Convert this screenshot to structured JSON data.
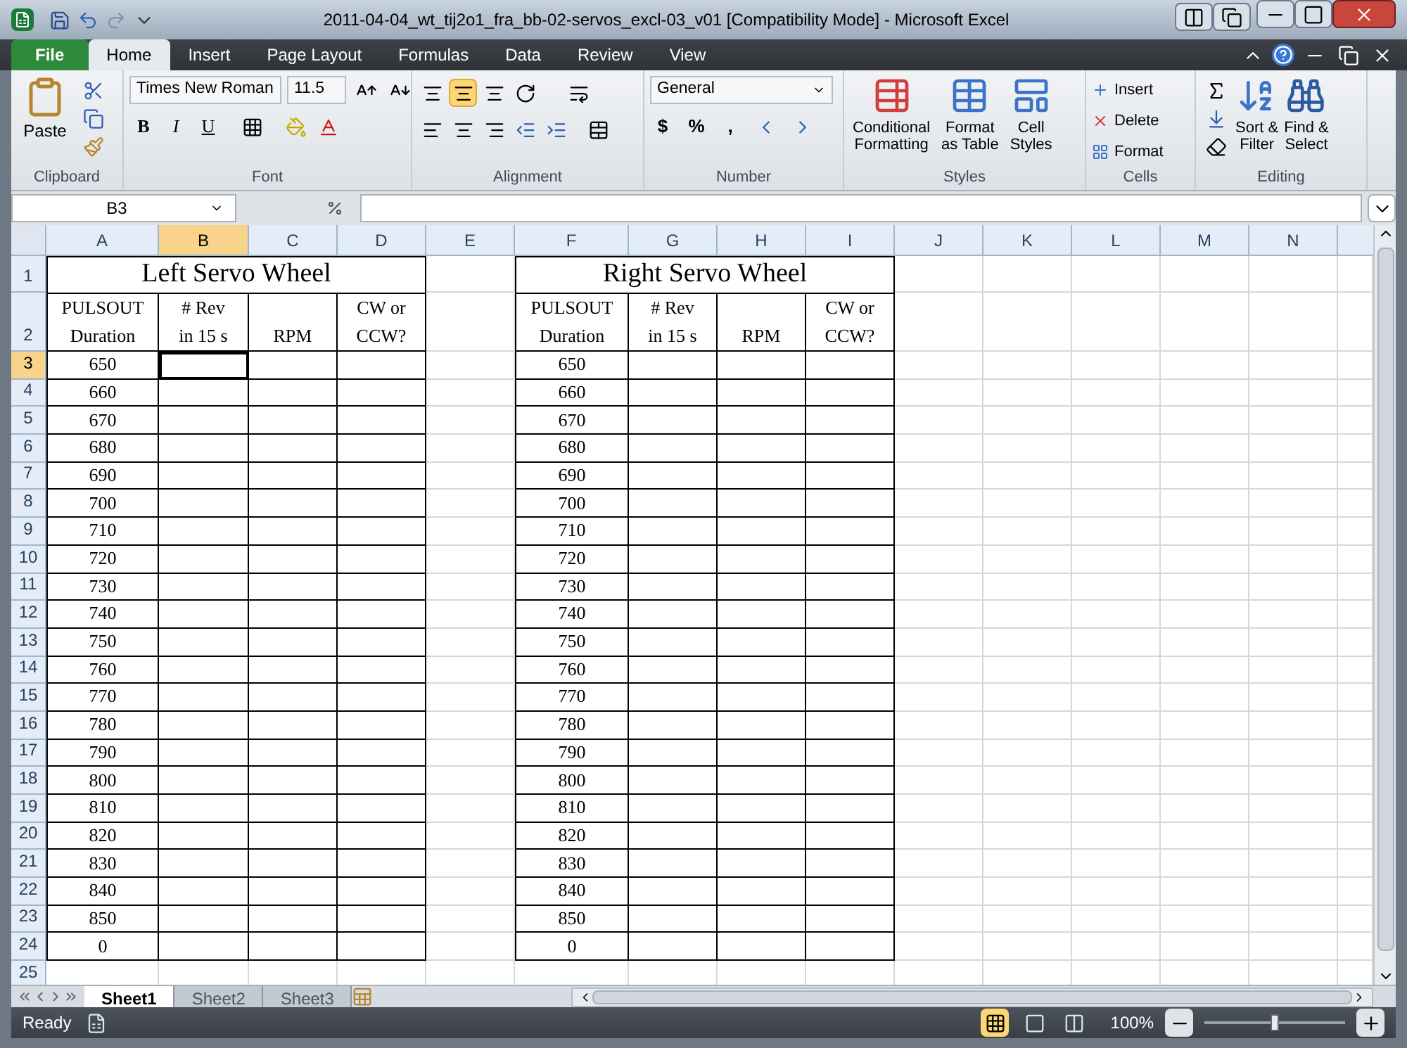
{
  "window": {
    "title": "2011-04-04_wt_tij2o1_fra_bb-02-servos_excl-03_v01  [Compatibility Mode]  -  Microsoft Excel"
  },
  "ribbon_tabs": [
    {
      "label": "File",
      "kind": "file",
      "selected": false
    },
    {
      "label": "Home",
      "kind": "tab",
      "selected": true
    },
    {
      "label": "Insert",
      "kind": "tab",
      "selected": false
    },
    {
      "label": "Page Layout",
      "kind": "tab",
      "selected": false
    },
    {
      "label": "Formulas",
      "kind": "tab",
      "selected": false
    },
    {
      "label": "Data",
      "kind": "tab",
      "selected": false
    },
    {
      "label": "Review",
      "kind": "tab",
      "selected": false
    },
    {
      "label": "View",
      "kind": "tab",
      "selected": false
    }
  ],
  "clipboard": {
    "label": "Clipboard",
    "paste": "Paste"
  },
  "font": {
    "label": "Font",
    "name": "Times New Roman",
    "size": "11.5",
    "styles": [
      "B",
      "I",
      "U"
    ]
  },
  "alignment": {
    "label": "Alignment",
    "middle_align_selected": true
  },
  "number": {
    "label": "Number",
    "format": "General",
    "symbols": [
      "$",
      "%",
      ","
    ]
  },
  "styles": {
    "label": "Styles",
    "buttons": [
      {
        "lines": [
          "Conditional",
          "Formatting"
        ]
      },
      {
        "lines": [
          "Format",
          "as Table"
        ]
      },
      {
        "lines": [
          "Cell",
          "Styles"
        ]
      }
    ]
  },
  "cells": {
    "label": "Cells",
    "buttons": [
      "Insert",
      "Delete",
      "Format"
    ]
  },
  "editing": {
    "label": "Editing",
    "buttons": [
      {
        "lines": [
          "Sort &",
          "Filter"
        ]
      },
      {
        "lines": [
          "Find &",
          "Select"
        ]
      }
    ]
  },
  "formula_bar": {
    "name_box": "B3"
  },
  "sheet": {
    "columns": [
      {
        "label": "A",
        "selected": false
      },
      {
        "label": "B",
        "selected": true
      },
      {
        "label": "C",
        "selected": false
      },
      {
        "label": "D",
        "selected": false
      },
      {
        "label": "E",
        "selected": false
      },
      {
        "label": "F",
        "selected": false
      },
      {
        "label": "G",
        "selected": false
      },
      {
        "label": "H",
        "selected": false
      },
      {
        "label": "I",
        "selected": false
      },
      {
        "label": "J",
        "selected": false
      },
      {
        "label": "K",
        "selected": false
      },
      {
        "label": "L",
        "selected": false
      },
      {
        "label": "M",
        "selected": false
      },
      {
        "label": "N",
        "selected": false
      }
    ],
    "rows": [
      {
        "label": "1",
        "selected": false
      },
      {
        "label": "2",
        "selected": false
      },
      {
        "label": "3",
        "selected": true
      },
      {
        "label": "4",
        "selected": false
      },
      {
        "label": "5",
        "selected": false
      },
      {
        "label": "6",
        "selected": false
      },
      {
        "label": "7",
        "selected": false
      },
      {
        "label": "8",
        "selected": false
      },
      {
        "label": "9",
        "selected": false
      },
      {
        "label": "10",
        "selected": false
      },
      {
        "label": "11",
        "selected": false
      },
      {
        "label": "12",
        "selected": false
      },
      {
        "label": "13",
        "selected": false
      },
      {
        "label": "14",
        "selected": false
      },
      {
        "label": "15",
        "selected": false
      },
      {
        "label": "16",
        "selected": false
      },
      {
        "label": "17",
        "selected": false
      },
      {
        "label": "18",
        "selected": false
      },
      {
        "label": "19",
        "selected": false
      },
      {
        "label": "20",
        "selected": false
      },
      {
        "label": "21",
        "selected": false
      },
      {
        "label": "22",
        "selected": false
      },
      {
        "label": "23",
        "selected": false
      },
      {
        "label": "24",
        "selected": false
      },
      {
        "label": "25",
        "selected": false
      }
    ],
    "tables": [
      {
        "title": "Left Servo Wheel",
        "headers": [
          [
            "PULSOUT",
            "Duration"
          ],
          [
            "# Rev",
            "in 15 s"
          ],
          [
            "RPM"
          ],
          [
            "CW or",
            "CCW?"
          ]
        ],
        "values": [
          "650",
          "660",
          "670",
          "680",
          "690",
          "700",
          "710",
          "720",
          "730",
          "740",
          "750",
          "760",
          "770",
          "780",
          "790",
          "800",
          "810",
          "820",
          "830",
          "840",
          "850",
          "0"
        ]
      },
      {
        "title": "Right Servo Wheel",
        "headers": [
          [
            "PULSOUT",
            "Duration"
          ],
          [
            "# Rev",
            "in 15 s"
          ],
          [
            "RPM"
          ],
          [
            "CW or",
            "CCW?"
          ]
        ],
        "values": [
          "650",
          "660",
          "670",
          "680",
          "690",
          "700",
          "710",
          "720",
          "730",
          "740",
          "750",
          "760",
          "770",
          "780",
          "790",
          "800",
          "810",
          "820",
          "830",
          "840",
          "850",
          "0"
        ]
      }
    ]
  },
  "sheet_tabs": [
    {
      "label": "Sheet1",
      "selected": true
    },
    {
      "label": "Sheet2",
      "selected": false
    },
    {
      "label": "Sheet3",
      "selected": false
    }
  ],
  "status_bar": {
    "state": "Ready",
    "views": [
      {
        "selected": true
      },
      {
        "selected": false
      },
      {
        "selected": false
      }
    ],
    "zoom": "100%",
    "zoom_slider": {
      "level": 0.5
    }
  }
}
